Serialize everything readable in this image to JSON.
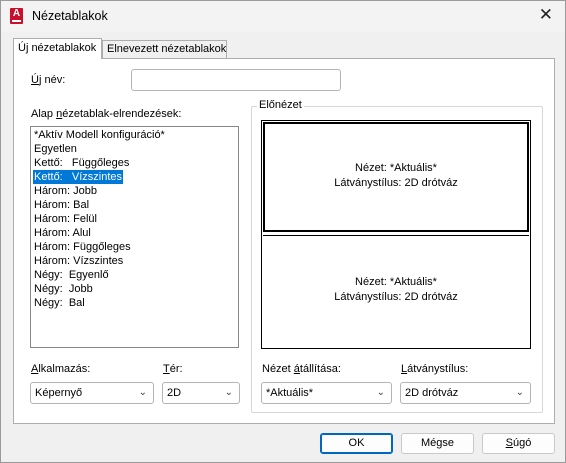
{
  "window": {
    "title": "Nézetablakok",
    "close_glyph": "✕"
  },
  "tabs": [
    {
      "label": "Új nézetablakok",
      "active": true
    },
    {
      "label": "Elnevezett nézetablakok",
      "active": false
    }
  ],
  "name_field": {
    "label_underlined": "Ú",
    "label_rest": "j név:",
    "value": ""
  },
  "layouts": {
    "label_pre": "Alap ",
    "label_underlined": "n",
    "label_rest": "ézetablak-elrendezések:",
    "items": [
      "*Aktív Modell konfiguráció*",
      "Egyetlen",
      "Kettő:   Függőleges",
      "Kettő:   Vízszintes",
      "Három: Jobb",
      "Három: Bal",
      "Három: Felül",
      "Három: Alul",
      "Három: Függőleges",
      "Három: Vízszintes",
      "Négy:  Egyenlő",
      "Négy:  Jobb",
      "Négy:  Bal"
    ],
    "selected_index": 3
  },
  "preview": {
    "legend": "Előnézet",
    "top": {
      "line1": "Nézet: *Aktuális*",
      "line2": "Látványstílus: 2D drótváz"
    },
    "bottom": {
      "line1": "Nézet: *Aktuális*",
      "line2": "Látványstílus: 2D drótváz"
    }
  },
  "apply": {
    "label_underlined": "A",
    "label_rest": "lkalmazás:",
    "value": "Képernyő"
  },
  "space": {
    "label_underlined": "T",
    "label_rest": "ér:",
    "value": "2D"
  },
  "view_change": {
    "label_pre": "Nézet ",
    "label_underlined": "á",
    "label_rest": "tállítása:",
    "value": "*Aktuális*"
  },
  "visual_style": {
    "label_pre": "",
    "label_underlined": "L",
    "label_rest": "átványstílus:",
    "value": "2D drótváz"
  },
  "buttons": {
    "ok": "OK",
    "cancel": "Mégse",
    "help_underlined": "S",
    "help_rest": "úgó"
  },
  "colors": {
    "selection": "#0078d7",
    "primary_border": "#0067c0",
    "app_icon": "#c8102e"
  }
}
